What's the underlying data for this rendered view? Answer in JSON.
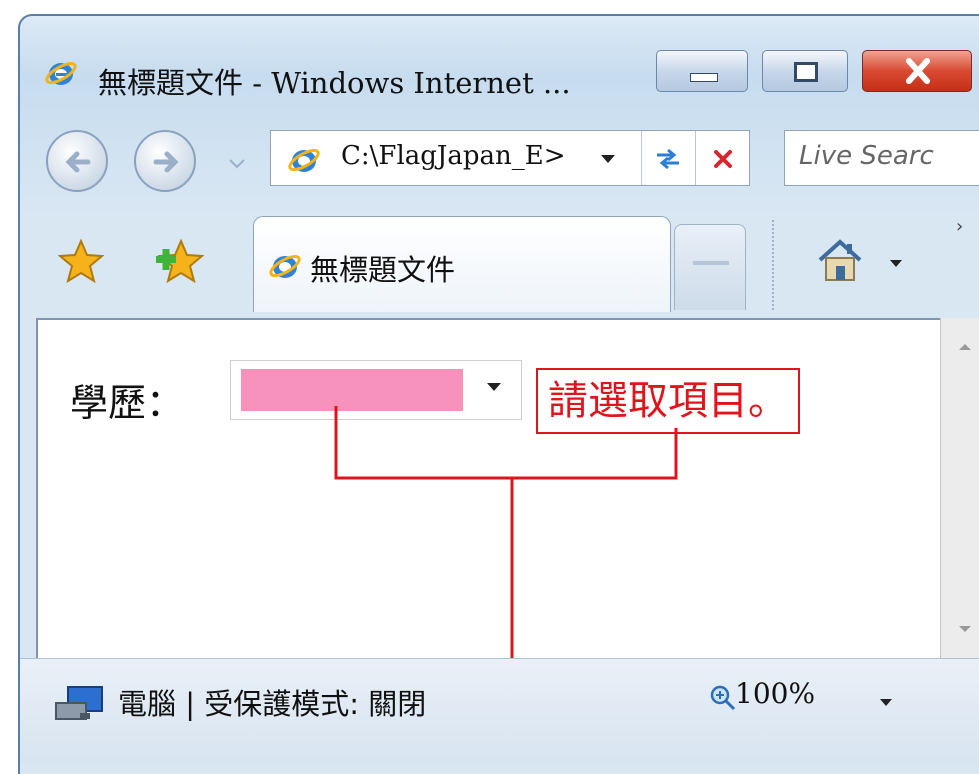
{
  "window": {
    "title": "無標題文件 - Windows Internet ...",
    "address": "C:\\FlagJapan_E>",
    "search_placeholder": "Live Searc",
    "tab_title": "無標題文件"
  },
  "page": {
    "field_label": "學歷：",
    "callout_text": "請選取項目。"
  },
  "status": {
    "zone": "電腦 | 受保護模式: 關閉",
    "zoom": "100%"
  },
  "colors": {
    "select_fill": "#f792bd",
    "annotation": "#e0141c"
  }
}
